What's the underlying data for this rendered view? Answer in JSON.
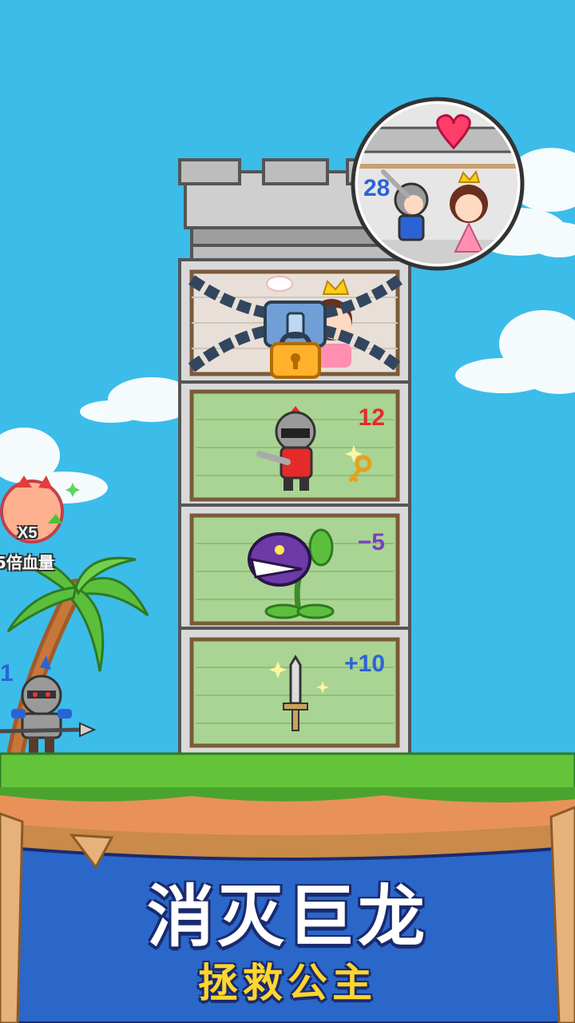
{
  "title": {
    "main": "消灭巨龙",
    "sub": "拯救公主"
  },
  "hero": {
    "power": "1",
    "power_preview": "28"
  },
  "boost": {
    "multiplier": "X5",
    "label": "5倍血量"
  },
  "tower": {
    "floors": [
      {
        "name": "knight-enemy",
        "value": "12",
        "value_color": "#e52a2a"
      },
      {
        "name": "piranha-plant",
        "value": "−5",
        "value_color": "#7a3fbf"
      },
      {
        "name": "sword-item",
        "value": "+10",
        "value_color": "#2b63d6"
      }
    ]
  },
  "colors": {
    "sky": "#3cbce9",
    "grass": "#63c43a",
    "dirt": "#e8925a",
    "banner": "#2a67c9",
    "tower_wall": "#d9d9d9",
    "room": "#a9d493"
  }
}
